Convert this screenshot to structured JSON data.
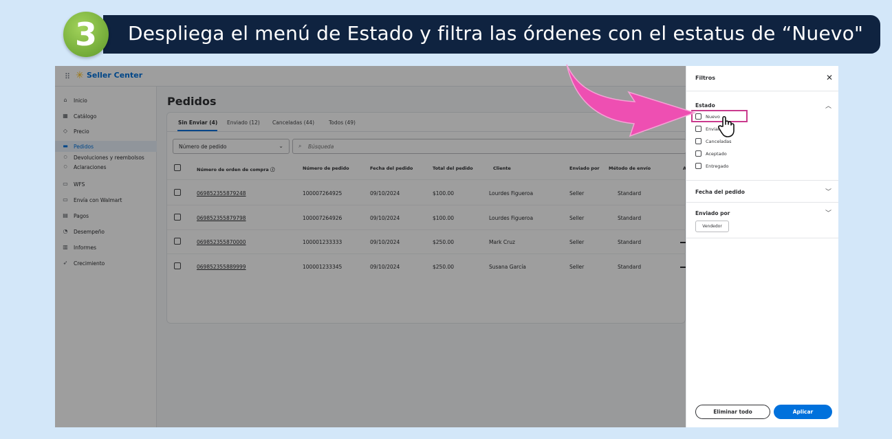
{
  "banner": {
    "step_number": "3",
    "text": "Despliega el menú de Estado y filtra las órdenes con el estatus de “Nuevo\""
  },
  "topbar": {
    "brand": "Seller Center"
  },
  "sidebar": {
    "items": [
      {
        "label": "Inicio",
        "icon": "home-icon"
      },
      {
        "label": "Catálogo",
        "icon": "catalog-icon"
      },
      {
        "label": "Precio",
        "icon": "price-tag-icon"
      },
      {
        "label": "Pedidos",
        "icon": "cart-icon"
      },
      {
        "label": "Devoluciones y reembolsos",
        "icon": "bullet-icon"
      },
      {
        "label": "Aclaraciones",
        "icon": "bullet-icon"
      },
      {
        "label": "WFS",
        "icon": "truck-icon"
      },
      {
        "label": "Envía con Walmart",
        "icon": "truck-icon"
      },
      {
        "label": "Pagos",
        "icon": "card-icon"
      },
      {
        "label": "Desempeño",
        "icon": "gauge-icon"
      },
      {
        "label": "Informes",
        "icon": "bar-chart-icon"
      },
      {
        "label": "Crecimiento",
        "icon": "rocket-icon"
      }
    ]
  },
  "main": {
    "title": "Pedidos",
    "tabs": [
      "Sin Enviar (4)",
      "Enviado (12)",
      "Canceladas (44)",
      "Todos (49)"
    ],
    "filter_select": "Número de pedido",
    "search_placeholder": "Búsqueda",
    "columns": [
      "Número de orden de compra ⓘ",
      "Número de pedido",
      "Fecha del pedido",
      "Total del pedido",
      "Cliente",
      "Enviado por",
      "Método de envío",
      "A"
    ],
    "rows": [
      [
        "069852355879248",
        "100007264925",
        "09/10/2024",
        "$100.00",
        "Lourdes Figueroa",
        "Seller",
        "Standard"
      ],
      [
        "069852355879798",
        "100007264926",
        "09/10/2024",
        "$100.00",
        "Lourdes Figueroa",
        "Seller",
        "Standard"
      ],
      [
        "069852355870000",
        "100001233333",
        "09/10/2024",
        "$250.00",
        "Mark Cruz",
        "Seller",
        "Standard"
      ],
      [
        "069852355889999",
        "100001233345",
        "09/10/2024",
        "$250.00",
        "Susana García",
        "Seller",
        "Standard"
      ]
    ]
  },
  "filters": {
    "title": "Filtros",
    "estado": {
      "title": "Estado",
      "options": [
        "Nuevo",
        "Enviado",
        "Canceladas",
        "Aceptado",
        "Entregado"
      ]
    },
    "fecha": {
      "title": "Fecha del pedido"
    },
    "enviado_por": {
      "title": "Enviado por",
      "chip": "Vendedor"
    },
    "clear_label": "Eliminar todo",
    "apply_label": "Aplicar"
  },
  "colors": {
    "banner_bg": "#0f2340",
    "step_green": "#7cb342",
    "accent_blue": "#0071dc",
    "highlight_pink": "#c93a8d",
    "arrow_pink": "#ee4fb2",
    "page_bg": "#d3e7f9"
  }
}
